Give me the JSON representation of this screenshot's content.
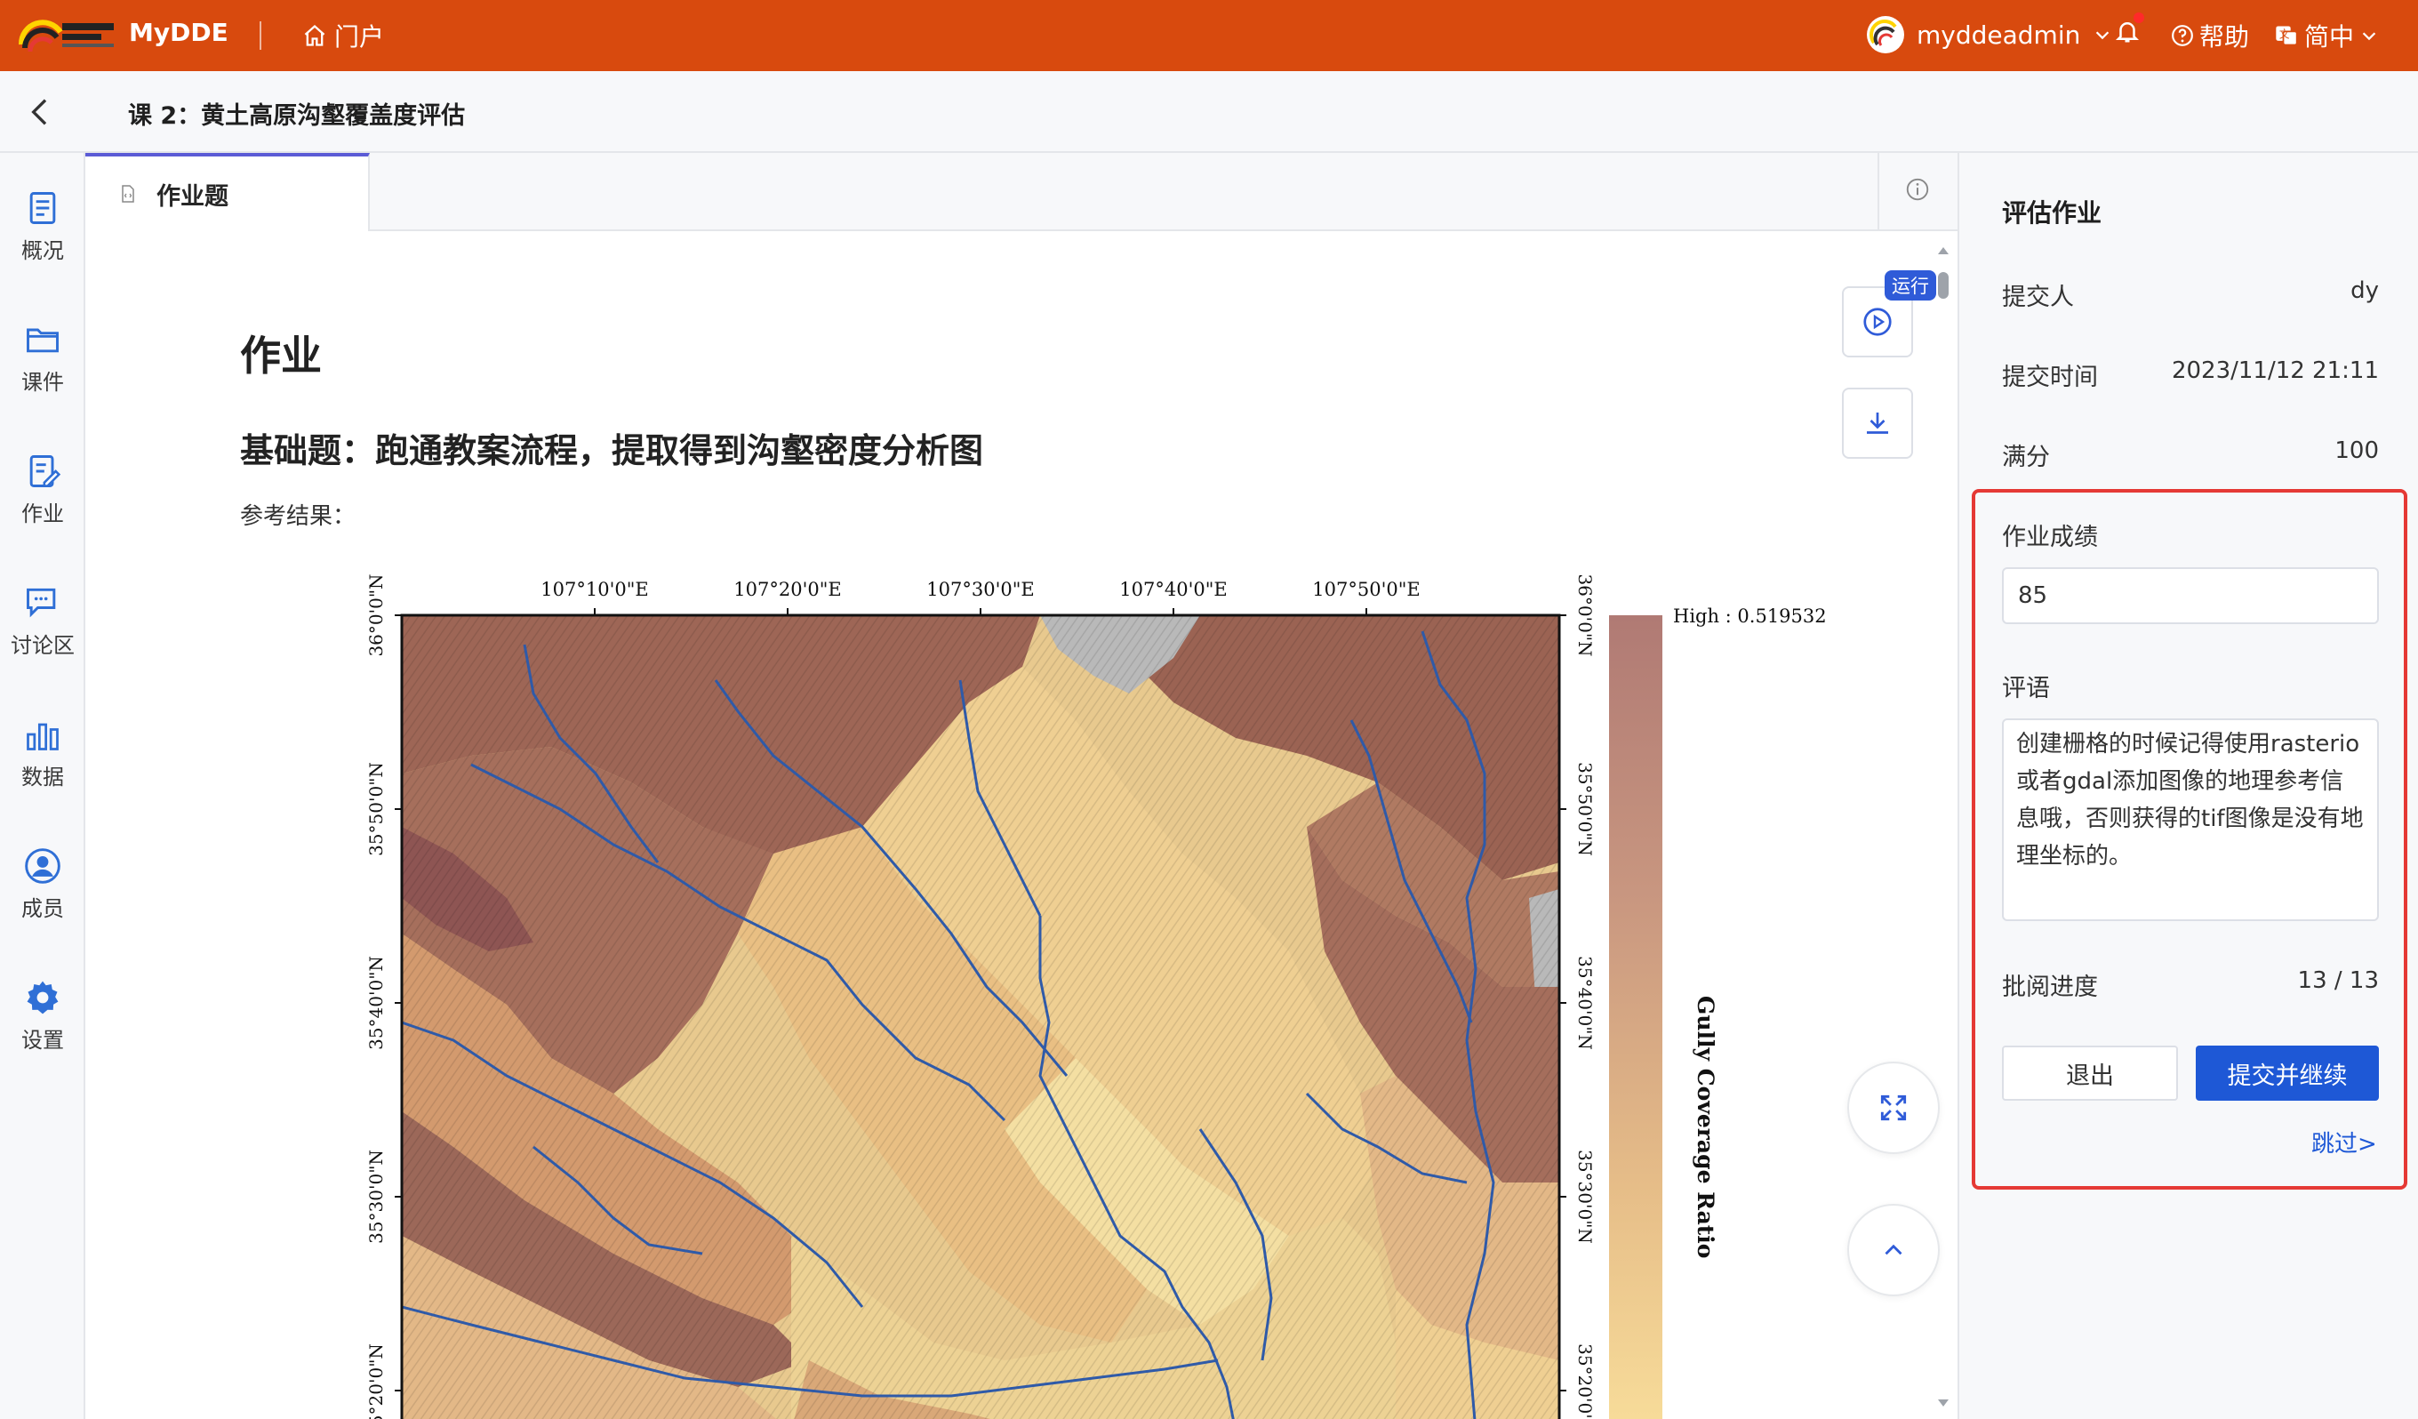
{
  "app": {
    "brand": "MyDDE",
    "portal_label": "门户",
    "username": "myddeadmin",
    "help_label": "帮助",
    "language_label": "简中"
  },
  "header": {
    "course_title": "课 2：黄土高原沟壑覆盖度评估"
  },
  "sidebar": {
    "items": [
      {
        "label": "概况",
        "icon": "overview-icon"
      },
      {
        "label": "课件",
        "icon": "courseware-icon"
      },
      {
        "label": "作业",
        "icon": "homework-icon"
      },
      {
        "label": "讨论区",
        "icon": "discussion-icon"
      },
      {
        "label": "数据",
        "icon": "data-icon"
      },
      {
        "label": "成员",
        "icon": "members-icon"
      },
      {
        "label": "设置",
        "icon": "settings-icon"
      }
    ]
  },
  "tabs": [
    {
      "label": "作业题",
      "active": true
    }
  ],
  "document": {
    "heading": "作业",
    "subheading": "基础题：跑通教案流程，提取得到沟壑密度分析图",
    "paragraph": "参考结果："
  },
  "map": {
    "top_ticks": [
      "107°10'0\"E",
      "107°20'0\"E",
      "107°30'0\"E",
      "107°40'0\"E",
      "107°50'0\"E"
    ],
    "left_ticks": [
      "36°0'0\"N",
      "35°50'0\"N",
      "35°40'0\"N",
      "35°30'0\"N",
      "35°20'0\"N"
    ],
    "legend_high": "High : 0.519532",
    "legend_title": "Gully Coverage Ratio"
  },
  "toolbar": {
    "run_badge": "运行"
  },
  "grading": {
    "title": "评估作业",
    "submitter_label": "提交人",
    "submitter_value": "dy",
    "time_label": "提交时间",
    "time_value": "2023/11/12 21:11",
    "full_score_label": "满分",
    "full_score_value": "100",
    "score_label": "作业成绩",
    "score_value": "85",
    "comment_label": "评语",
    "comment_value": "创建栅格的时候记得使用rasterio或者gdal添加图像的地理参考信息哦，否则获得的tif图像是没有地理坐标的。",
    "progress_label": "批阅进度",
    "progress_value": "13 / 13",
    "exit_label": "退出",
    "submit_label": "提交并继续",
    "skip_label": "跳过>"
  },
  "colors": {
    "topbar": "#d84a0e",
    "accent_blue": "#1e58d6",
    "highlight_red": "#e53935"
  }
}
